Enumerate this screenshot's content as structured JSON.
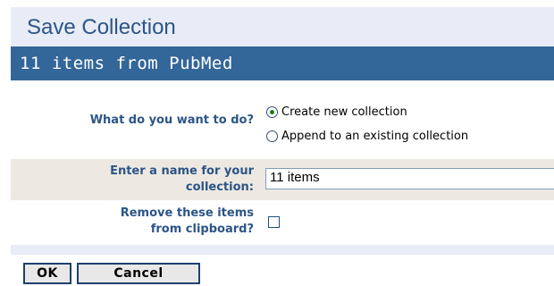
{
  "dialog": {
    "title": "Save Collection",
    "source": "11 items from PubMed"
  },
  "action": {
    "label": "What do you want to do?",
    "options": [
      "Create new collection",
      "Append to an existing collection"
    ],
    "selected": "Create new collection"
  },
  "name": {
    "label_line1": "Enter a name for your",
    "label_line2": "collection:",
    "value": "11 items"
  },
  "remove": {
    "label_line1": "Remove these items",
    "label_line2": "from clipboard?",
    "checked": false
  },
  "buttons": {
    "ok": "OK",
    "cancel": "Cancel"
  },
  "colors": {
    "title_text": "#2c5587",
    "header_bar": "#336699",
    "panel_bg": "#e7ecf6"
  }
}
